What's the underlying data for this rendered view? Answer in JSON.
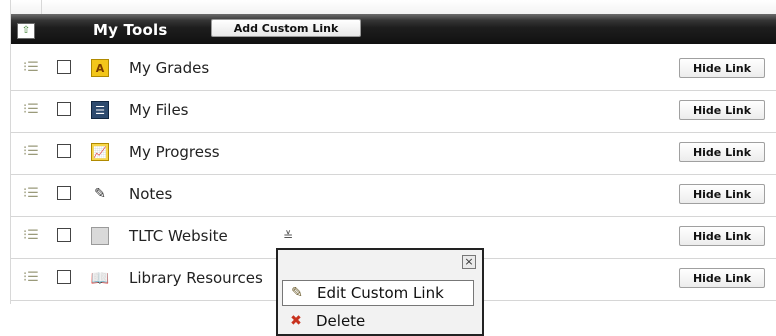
{
  "header": {
    "title": "My Tools",
    "add_button": "Add Custom Link",
    "collapse_glyph": "⇧"
  },
  "tools": [
    {
      "label": "My Grades",
      "icon": "grades-icon",
      "glyph": "A",
      "button": "Hide Link"
    },
    {
      "label": "My Files",
      "icon": "files-icon",
      "glyph": "☰",
      "button": "Hide Link"
    },
    {
      "label": "My Progress",
      "icon": "progress-icon",
      "glyph": "📈",
      "button": "Hide Link"
    },
    {
      "label": "Notes",
      "icon": "notes-icon",
      "glyph": "✎",
      "button": "Hide Link"
    },
    {
      "label": "TLTC Website",
      "icon": "link-icon",
      "glyph": "",
      "button": "Hide Link"
    },
    {
      "label": "Library Resources",
      "icon": "book-icon",
      "glyph": "📖",
      "button": "Hide Link"
    }
  ],
  "context_menu": {
    "close": "×",
    "items": [
      {
        "label": "Edit Custom Link",
        "icon": "pencil-icon",
        "glyph": "✎"
      },
      {
        "label": "Delete",
        "icon": "delete-icon",
        "glyph": "✖"
      }
    ]
  },
  "glyphs": {
    "drag": "⁝☰",
    "menu_toggle": "≚"
  },
  "colors": {
    "header_bg": "#1e1e1e",
    "accent_green": "#3a7f2e",
    "grades_icon": "#e8b400"
  }
}
